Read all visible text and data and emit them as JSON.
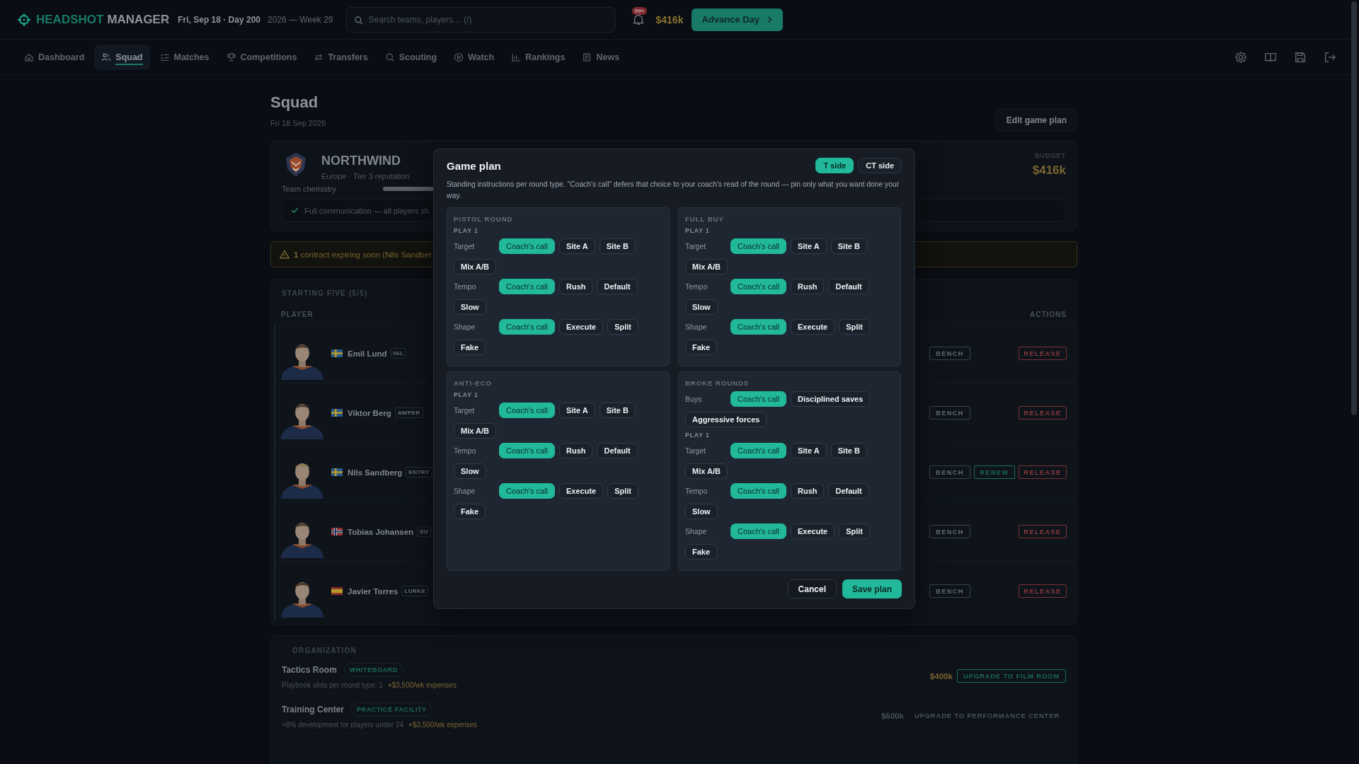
{
  "topbar": {
    "brand_first": "HEADSHOT",
    "brand_second": "MANAGER",
    "date": "Fri, Sep 18 · Day 200",
    "week": "2026 — Week 29",
    "search": {
      "placeholder": "Search teams, players… (/)"
    },
    "notifications_badge": "99+",
    "money": "$416k",
    "advance_button": "Advance Day"
  },
  "nav": {
    "tabs": [
      {
        "label": "Dashboard",
        "selected": false
      },
      {
        "label": "Squad",
        "selected": true
      },
      {
        "label": "Matches",
        "selected": false
      },
      {
        "label": "Competitions",
        "selected": false
      },
      {
        "label": "Transfers",
        "selected": false
      },
      {
        "label": "Scouting",
        "selected": false
      },
      {
        "label": "Watch",
        "selected": false
      },
      {
        "label": "Rankings",
        "selected": false
      },
      {
        "label": "News",
        "selected": false
      }
    ]
  },
  "page": {
    "title": "Squad",
    "date": "Fri 18 Sep 2026",
    "edit_button": "Edit game plan"
  },
  "team": {
    "name": "NORTHWIND",
    "subtitle": "Europe · Tier 3 reputation",
    "chemistry_label": "Team chemistry",
    "chemistry_note": "Full communication — all players sh",
    "budget_label": "BUDGET",
    "budget": "$416k"
  },
  "warning": {
    "text": "**1** contract expiring soon (Nils Sandber"
  },
  "starting_five": {
    "title": "STARTING FIVE (5/5)",
    "columns": [
      "PLAYER",
      "ACTIONS"
    ],
    "players": [
      {
        "name": "Emil Lund",
        "role": "IGL",
        "actions": [
          {
            "label": "BENCH",
            "kind": "bench"
          },
          {
            "label": "RELEASE",
            "kind": "release"
          }
        ]
      },
      {
        "name": "Viktor Berg",
        "role": "AWPER",
        "actions": [
          {
            "label": "BENCH",
            "kind": "bench"
          },
          {
            "label": "RELEASE",
            "kind": "release"
          }
        ]
      },
      {
        "name": "Nils Sandberg",
        "role": "ENTRY",
        "actions": [
          {
            "label": "BENCH",
            "kind": "bench"
          },
          {
            "label": "RENEW",
            "kind": "renew"
          },
          {
            "label": "RELEASE",
            "kind": "release"
          }
        ]
      },
      {
        "name": "Tobias Johansen",
        "role": "SU",
        "actions": [
          {
            "label": "BENCH",
            "kind": "bench"
          },
          {
            "label": "RELEASE",
            "kind": "release"
          }
        ]
      },
      {
        "name": "Javier Torres",
        "role": "LURKE",
        "actions": [
          {
            "label": "BENCH",
            "kind": "bench"
          },
          {
            "label": "RELEASE",
            "kind": "release"
          }
        ]
      }
    ]
  },
  "organization": {
    "title": "ORGANIZATION",
    "facilities": [
      {
        "name": "Tactics Room",
        "tier": "WHITEBOARD",
        "effect": "Playbook slots per round type: 1",
        "expense": "+$3,500/wk expenses",
        "price": "$400k",
        "upgrade": "UPGRADE TO FILM ROOM",
        "disabled": false
      },
      {
        "name": "Training Center",
        "tier": "PRACTICE FACILITY",
        "effect": "+8% development for players under 24",
        "expense": "+$3,500/wk expenses",
        "price": "$600k",
        "upgrade": "UPGRADE TO PERFORMANCE CENTER",
        "disabled": true
      }
    ]
  },
  "modal": {
    "title": "Game plan",
    "sides": [
      {
        "label": "T side",
        "selected": true
      },
      {
        "label": "CT side",
        "selected": false
      }
    ],
    "description": "Standing instructions per round type. \"Coach's call\" defers that choice to your coach's read of the round — pin only what you want done your way.",
    "sections": [
      {
        "title": "PISTOL ROUND",
        "items": [
          {
            "kind": "heading",
            "text": "PLAY 1"
          },
          {
            "kind": "row",
            "label": "Target",
            "options": [
              {
                "label": "Coach's call",
                "selected": true
              },
              {
                "label": "Site A",
                "selected": false
              },
              {
                "label": "Site B",
                "selected": false
              },
              {
                "label": "Mix A/B",
                "selected": false
              }
            ]
          },
          {
            "kind": "row",
            "label": "Tempo",
            "options": [
              {
                "label": "Coach's call",
                "selected": true
              },
              {
                "label": "Rush",
                "selected": false
              },
              {
                "label": "Default",
                "selected": false
              },
              {
                "label": "Slow",
                "selected": false
              }
            ]
          },
          {
            "kind": "row",
            "label": "Shape",
            "options": [
              {
                "label": "Coach's call",
                "selected": true
              },
              {
                "label": "Execute",
                "selected": false
              },
              {
                "label": "Split",
                "selected": false
              },
              {
                "label": "Fake",
                "selected": false
              }
            ]
          }
        ]
      },
      {
        "title": "FULL BUY",
        "items": [
          {
            "kind": "heading",
            "text": "PLAY 1"
          },
          {
            "kind": "row",
            "label": "Target",
            "options": [
              {
                "label": "Coach's call",
                "selected": true
              },
              {
                "label": "Site A",
                "selected": false
              },
              {
                "label": "Site B",
                "selected": false
              },
              {
                "label": "Mix A/B",
                "selected": false
              }
            ]
          },
          {
            "kind": "row",
            "label": "Tempo",
            "options": [
              {
                "label": "Coach's call",
                "selected": true
              },
              {
                "label": "Rush",
                "selected": false
              },
              {
                "label": "Default",
                "selected": false
              },
              {
                "label": "Slow",
                "selected": false
              }
            ]
          },
          {
            "kind": "row",
            "label": "Shape",
            "options": [
              {
                "label": "Coach's call",
                "selected": true
              },
              {
                "label": "Execute",
                "selected": false
              },
              {
                "label": "Split",
                "selected": false
              },
              {
                "label": "Fake",
                "selected": false
              }
            ]
          }
        ]
      },
      {
        "title": "ANTI-ECO",
        "items": [
          {
            "kind": "heading",
            "text": "PLAY 1"
          },
          {
            "kind": "row",
            "label": "Target",
            "options": [
              {
                "label": "Coach's call",
                "selected": true
              },
              {
                "label": "Site A",
                "selected": false
              },
              {
                "label": "Site B",
                "selected": false
              },
              {
                "label": "Mix A/B",
                "selected": false
              }
            ]
          },
          {
            "kind": "row",
            "label": "Tempo",
            "options": [
              {
                "label": "Coach's call",
                "selected": true
              },
              {
                "label": "Rush",
                "selected": false
              },
              {
                "label": "Default",
                "selected": false
              },
              {
                "label": "Slow",
                "selected": false
              }
            ]
          },
          {
            "kind": "row",
            "label": "Shape",
            "options": [
              {
                "label": "Coach's call",
                "selected": true
              },
              {
                "label": "Execute",
                "selected": false
              },
              {
                "label": "Split",
                "selected": false
              },
              {
                "label": "Fake",
                "selected": false
              }
            ]
          }
        ]
      },
      {
        "title": "BROKE ROUNDS",
        "items": [
          {
            "kind": "row",
            "label": "Buys",
            "options": [
              {
                "label": "Coach's call",
                "selected": true
              },
              {
                "label": "Disciplined saves",
                "selected": false
              },
              {
                "label": "Aggressive forces",
                "selected": false
              }
            ]
          },
          {
            "kind": "heading",
            "text": "PLAY 1"
          },
          {
            "kind": "row",
            "label": "Target",
            "options": [
              {
                "label": "Coach's call",
                "selected": true
              },
              {
                "label": "Site A",
                "selected": false
              },
              {
                "label": "Site B",
                "selected": false
              },
              {
                "label": "Mix A/B",
                "selected": false
              }
            ]
          },
          {
            "kind": "row",
            "label": "Tempo",
            "options": [
              {
                "label": "Coach's call",
                "selected": true
              },
              {
                "label": "Rush",
                "selected": false
              },
              {
                "label": "Default",
                "selected": false
              },
              {
                "label": "Slow",
                "selected": false
              }
            ]
          },
          {
            "kind": "row",
            "label": "Shape",
            "options": [
              {
                "label": "Coach's call",
                "selected": true
              },
              {
                "label": "Execute",
                "selected": false
              },
              {
                "label": "Split",
                "selected": false
              },
              {
                "label": "Fake",
                "selected": false
              }
            ]
          }
        ]
      }
    ],
    "cancel_button": "Cancel",
    "save_button": "Save plan"
  }
}
